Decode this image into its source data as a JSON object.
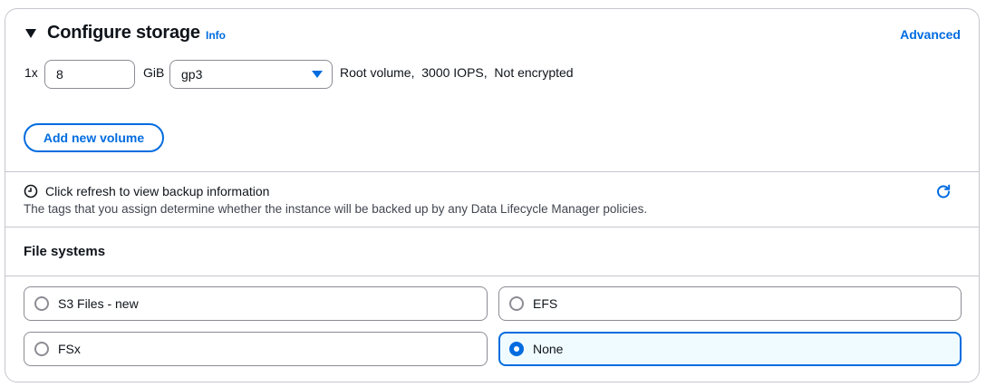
{
  "header": {
    "title": "Configure storage",
    "info_link": "Info",
    "advanced_link": "Advanced"
  },
  "volume": {
    "count_prefix": "1x",
    "size_value": "8",
    "size_unit": "GiB",
    "type_value": "gp3",
    "summary": "Root volume,  3000 IOPS,  Not encrypted"
  },
  "add_volume_label": "Add new volume",
  "backup": {
    "title": "Click refresh to view backup information",
    "description": "The tags that you assign determine whether the instance will be backed up by any Data Lifecycle Manager policies."
  },
  "file_systems": {
    "title": "File systems",
    "options": [
      {
        "label": "S3 Files - new",
        "selected": false
      },
      {
        "label": "EFS",
        "selected": false
      },
      {
        "label": "FSx",
        "selected": false
      },
      {
        "label": "None",
        "selected": true
      }
    ]
  },
  "colors": {
    "accent": "#006ce0",
    "border": "#c6c6cd",
    "selected_bg": "#f0fbff"
  }
}
